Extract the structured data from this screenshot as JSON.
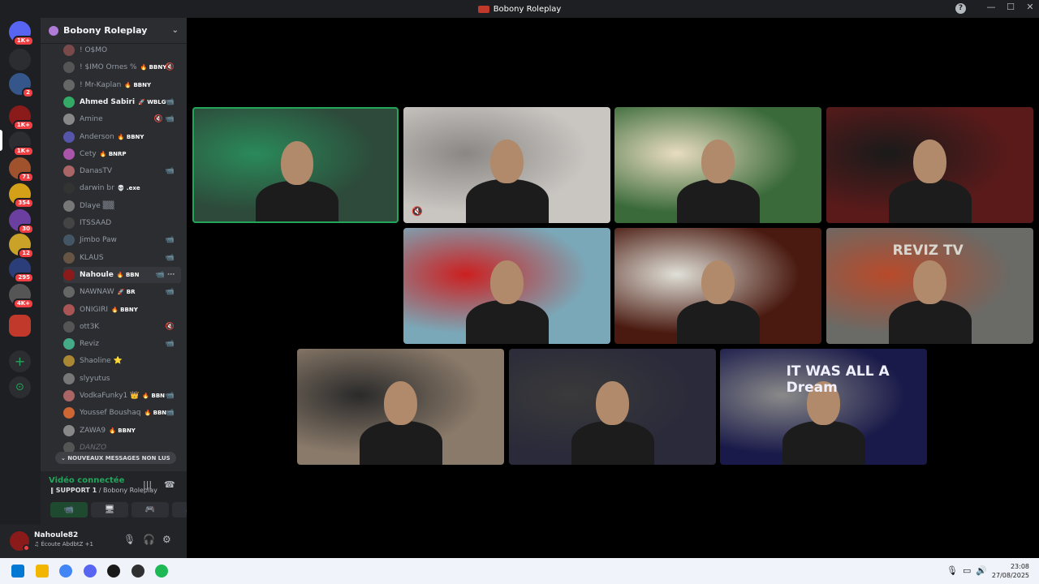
{
  "window": {
    "title": "Bobony Roleplay",
    "help_label": "?",
    "minimize": "—",
    "maximize": "☐",
    "close": "✕"
  },
  "servers": [
    {
      "name": "discord-home",
      "badge": "1K+",
      "color": "#5865f2"
    },
    {
      "name": "inbox",
      "badge": "",
      "color": "#2b2d31"
    },
    {
      "name": "server-2",
      "badge": "2",
      "color": "#34568b"
    },
    {
      "name": "server-red",
      "badge": "1K+",
      "color": "#8b1a1a"
    },
    {
      "name": "server-green",
      "badge": "1K+",
      "color": "#2b2d31"
    },
    {
      "name": "server-71",
      "badge": "71",
      "color": "#a0522d"
    },
    {
      "name": "server-354",
      "badge": "354",
      "color": "#d4a017"
    },
    {
      "name": "server-30",
      "badge": "30",
      "color": "#6b3fa0"
    },
    {
      "name": "server-12",
      "badge": "12",
      "color": "#c9a227"
    },
    {
      "name": "server-295",
      "badge": "295",
      "color": "#2c3e7a"
    },
    {
      "name": "server-4k",
      "badge": "4K+",
      "color": "#555"
    },
    {
      "name": "server-bobony",
      "badge": "",
      "color": "#c0392b"
    }
  ],
  "sidebar_actions": {
    "add": "+",
    "explore": "⊙"
  },
  "server": {
    "name": "Bobony Roleplay",
    "chevron": "⌄"
  },
  "members": [
    {
      "name": "! O$MO",
      "tag": "",
      "color": "#7a4a4a",
      "bright": false,
      "icon": ""
    },
    {
      "name": "! $IMO Ornes %",
      "tag": "🔥 BBNY",
      "color": "#555",
      "bright": false,
      "icon": "🔇"
    },
    {
      "name": "! Mr-Kaplan",
      "tag": "🔥 BBNY",
      "color": "#666",
      "bright": false,
      "icon": ""
    },
    {
      "name": "Ahmed Sabiri",
      "tag": "🚀 WBLG",
      "color": "#3a6",
      "bright": true,
      "icon": "📹"
    },
    {
      "name": "Amine",
      "tag": "",
      "color": "#888",
      "bright": false,
      "icon": "🔇 📹"
    },
    {
      "name": "Anderson",
      "tag": "🔥 BBNY",
      "color": "#55a",
      "bright": false,
      "icon": ""
    },
    {
      "name": "Cety",
      "tag": "🔥 BNRP",
      "color": "#a5a",
      "bright": false,
      "icon": ""
    },
    {
      "name": "DanasTV",
      "tag": "",
      "color": "#a66",
      "bright": false,
      "icon": "📹"
    },
    {
      "name": "darwin br",
      "tag": "💀 .exe",
      "color": "#333",
      "bright": false,
      "icon": ""
    },
    {
      "name": "Dlaye ▒▒",
      "tag": "",
      "color": "#777",
      "bright": false,
      "icon": ""
    },
    {
      "name": "ITSSAAD",
      "tag": "",
      "color": "#444",
      "bright": false,
      "icon": ""
    },
    {
      "name": "Jimbo Paw",
      "tag": "",
      "color": "#456",
      "bright": false,
      "icon": "📹"
    },
    {
      "name": "KLAUS",
      "tag": "",
      "color": "#654",
      "bright": false,
      "icon": "📹"
    },
    {
      "name": "Nahoule",
      "tag": "🔥 BBN",
      "color": "#8b1a1a",
      "bright": true,
      "icon": "📹 ⋯"
    },
    {
      "name": "NAWNAW",
      "tag": "🚀 BR",
      "color": "#666",
      "bright": false,
      "icon": "📹"
    },
    {
      "name": "ONIGIRI",
      "tag": "🔥 BBNY",
      "color": "#a55",
      "bright": false,
      "icon": ""
    },
    {
      "name": "ott3K",
      "tag": "",
      "color": "#555",
      "bright": false,
      "icon": "🔇"
    },
    {
      "name": "Reviz",
      "tag": "",
      "color": "#4a8",
      "bright": false,
      "icon": "📹"
    },
    {
      "name": "Shaoline ⭐",
      "tag": "",
      "color": "#a83",
      "bright": false,
      "icon": ""
    },
    {
      "name": "slyyutus",
      "tag": "",
      "color": "#777",
      "bright": false,
      "icon": ""
    },
    {
      "name": "VodkaFunky1 👑",
      "tag": "🔥 BBN",
      "color": "#a66",
      "bright": false,
      "icon": "📹"
    },
    {
      "name": "Youssef Boushaq",
      "tag": "🔥 BBN",
      "color": "#c63",
      "bright": false,
      "icon": "📹"
    },
    {
      "name": "ZAWA9",
      "tag": "🔥 BBNY",
      "color": "#888",
      "bright": false,
      "icon": ""
    },
    {
      "name": "DANZO",
      "tag": "",
      "color": "#555",
      "bright": false,
      "icon": ""
    }
  ],
  "unread_banner": "⌄ NOUVEAUX MESSAGES NON LUS",
  "voice": {
    "status": "Vidéo connectée",
    "channel_prefix": "‖ SUPPORT 1",
    "channel_suffix": " / Bobony Roleplay",
    "buttons": [
      "📹",
      "🖥",
      "🎮",
      "✨"
    ]
  },
  "user": {
    "name": "Nahoule82",
    "status": "♫ Écoute AbdbtZ +1"
  },
  "video_tiles": [
    {
      "id": "tile-1",
      "speaking": true,
      "muted": false,
      "bg": "#2d4a3a",
      "accent": "#2a8a5a",
      "overlay": ""
    },
    {
      "id": "tile-2",
      "speaking": false,
      "muted": true,
      "bg": "#c9c6c2",
      "accent": "#8a8784",
      "overlay": ""
    },
    {
      "id": "tile-3",
      "speaking": false,
      "muted": false,
      "bg": "#3a6a3a",
      "accent": "#e8dcc0",
      "overlay": ""
    },
    {
      "id": "tile-4",
      "speaking": false,
      "muted": false,
      "bg": "#5a1a1a",
      "accent": "#1a1a1a",
      "overlay": ""
    },
    {
      "id": "tile-5",
      "speaking": false,
      "muted": false,
      "bg": "#7aa8b8",
      "accent": "#cc2020",
      "overlay": ""
    },
    {
      "id": "tile-6",
      "speaking": false,
      "muted": false,
      "bg": "#4a1a10",
      "accent": "#e0e0d8",
      "overlay": ""
    },
    {
      "id": "tile-7",
      "speaking": false,
      "muted": false,
      "bg": "#6a6a66",
      "accent": "#b84a2a",
      "overlay": "REVIZ TV"
    },
    {
      "id": "tile-8",
      "speaking": false,
      "muted": false,
      "bg": "#8a7a6a",
      "accent": "#2a2a2a",
      "overlay": ""
    },
    {
      "id": "tile-9",
      "speaking": false,
      "muted": false,
      "bg": "#2a2a3a",
      "accent": "#3a3a3a",
      "overlay": ""
    },
    {
      "id": "tile-10",
      "speaking": false,
      "muted": false,
      "bg": "#1a1a4a",
      "accent": "#8a8a8a",
      "overlay": "IT WAS ALL A Dream"
    }
  ],
  "taskbar": {
    "time": "23:08",
    "date": "27/08/2025",
    "apps": [
      "windows-start",
      "file-explorer",
      "chrome",
      "discord",
      "capcut",
      "obs",
      "spotify"
    ]
  }
}
